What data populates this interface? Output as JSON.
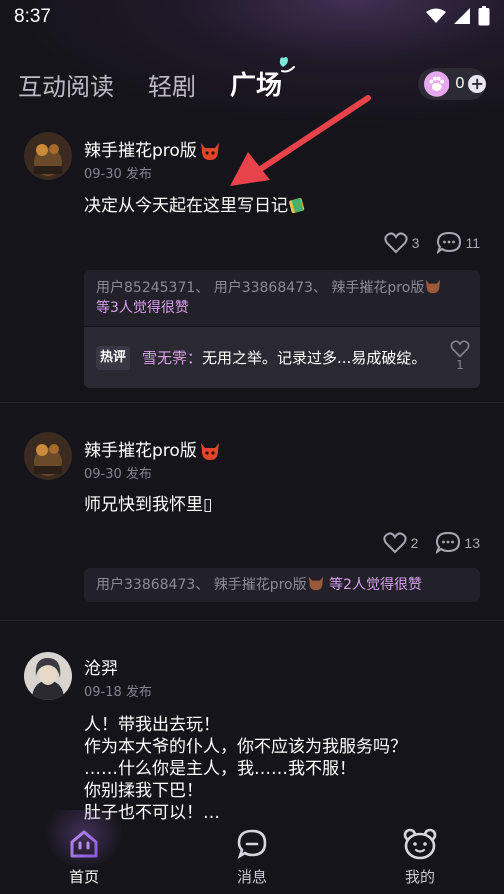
{
  "status_bar": {
    "time": "8:37",
    "icons": [
      "wifi-icon",
      "signal-icon",
      "battery-icon"
    ]
  },
  "tabs": [
    {
      "label": "互动阅读",
      "active": false
    },
    {
      "label": "轻剧",
      "active": false
    },
    {
      "label": "广场",
      "active": true
    }
  ],
  "paw_counter": {
    "count": "0",
    "icon": "paw-icon",
    "plus": "+"
  },
  "posts": [
    {
      "author": "辣手摧花pro版",
      "badge": "devil-emoji",
      "date": "09-30 发布",
      "text": "决定从今天起在这里写日记",
      "text_emoji": "notebook-emoji",
      "likes": "3",
      "comments": "11",
      "liked_by": "用户85245371、 用户33868473、 辣手摧花pro版",
      "liked_by_suffix": "等3人觉得很赞",
      "hot_comment": {
        "tag": "热评",
        "user": "雪无霁：",
        "text": "无用之举。记录过多...易成破绽。",
        "likes": "1"
      }
    },
    {
      "author": "辣手摧花pro版",
      "badge": "devil-emoji",
      "date": "09-30 发布",
      "text": "师兄快到我怀里▯",
      "likes": "2",
      "comments": "13",
      "liked_by": "用户33868473、 辣手摧花pro版",
      "liked_by_suffix": "等2人觉得很赞"
    },
    {
      "author": "沧羿",
      "date": "09-18 发布",
      "text_lines": [
        "人！带我出去玩！",
        "作为本大爷的仆人，你不应该为我服务吗？",
        "……什么你是主人，我……我不服！",
        "你别揉我下巴！",
        "肚子也不可以！…"
      ]
    }
  ],
  "bottom_nav": [
    {
      "label": "首页",
      "icon": "home-icon",
      "active": true
    },
    {
      "label": "消息",
      "icon": "message-icon",
      "active": false
    },
    {
      "label": "我的",
      "icon": "bear-face-icon",
      "active": false
    }
  ],
  "colors": {
    "background": "#15141a",
    "accent": "#d9a0ee",
    "annotation_arrow": "#e8424a"
  }
}
